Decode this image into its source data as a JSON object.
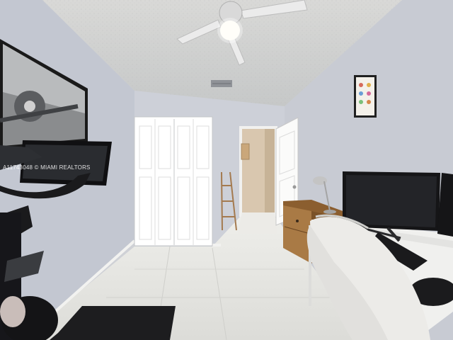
{
  "photo": {
    "subject": "bedroom office",
    "watermark": "A11743048 © MIAMI REALTORS",
    "colors": {
      "wall": "#c9ccd4",
      "ceiling": "#d3d4d3",
      "floor": "#e6e6e2",
      "doors": "#f4f4f2",
      "hallway": "#d8c6ae",
      "cabinet": "#a97a45",
      "monitor": "#161618"
    }
  }
}
